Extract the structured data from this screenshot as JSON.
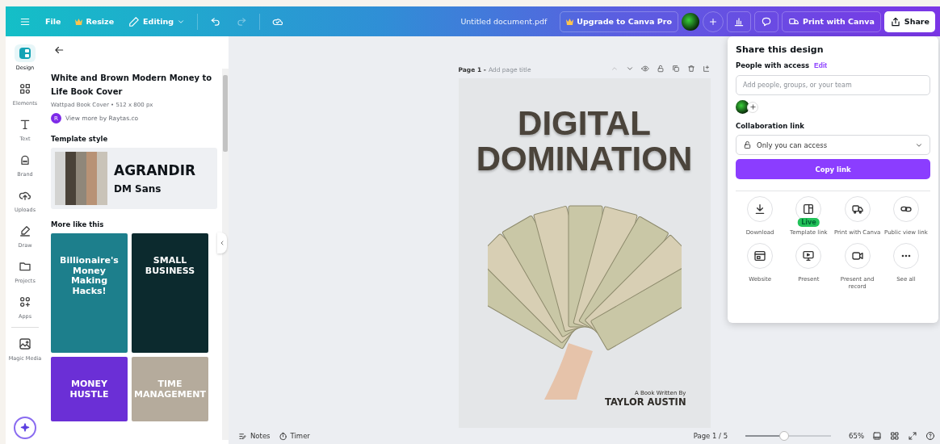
{
  "topbar": {
    "menu_items": [
      {
        "label": "File",
        "kind": "plain"
      },
      {
        "label": "Resize",
        "kind": "crown"
      },
      {
        "label": "Editing",
        "kind": "mode"
      }
    ],
    "document_title": "Untitled document.pdf",
    "upgrade_button": "Upgrade to Canva Pro",
    "print_button": "Print with Canva",
    "share_button": {
      "label": "Share",
      "selected": true
    }
  },
  "rail": {
    "items": [
      {
        "label": "Design",
        "selected": true
      },
      {
        "label": "Elements",
        "selected": false
      },
      {
        "label": "Text",
        "selected": false
      },
      {
        "label": "Brand",
        "selected": false
      },
      {
        "label": "Uploads",
        "selected": false
      },
      {
        "label": "Draw",
        "selected": false
      },
      {
        "label": "Projects",
        "selected": false
      },
      {
        "label": "Apps",
        "selected": false
      },
      {
        "label": "Magic Media",
        "selected": false
      }
    ]
  },
  "panel": {
    "title": "White and Brown Modern Money to Life Book Cover",
    "meta": "Wattpad Book Cover • 512 x 800 px",
    "creator_initial": "R",
    "creator_link": "View more by Raytas.co",
    "style_heading": "Template style",
    "palette": [
      {
        "color": "#d3d3d1"
      },
      {
        "color": "#4a4238"
      },
      {
        "color": "#8f877a"
      },
      {
        "color": "#b89275"
      },
      {
        "color": "#c9c3b8"
      }
    ],
    "heading_font": "AGRANDIR",
    "body_font": "DM Sans",
    "more_heading": "More like this",
    "templates": [
      {
        "title": "Billionaire's Money Making Hacks!",
        "color": "#1d7f8c"
      },
      {
        "title": "SMALL BUSINESS",
        "color": "#0c2a2e"
      },
      {
        "title": "MONEY HUSTLE",
        "color": "#6b2fd6"
      },
      {
        "title": "TIME MANAGEMENT",
        "color": "#b5ab9c"
      }
    ]
  },
  "canvas": {
    "page_label": "Page 1 -",
    "page_title_placeholder": "Add page title",
    "design": {
      "title_lines": [
        "DIGITAL",
        "DOMINATION"
      ],
      "byline": "A Book Written By",
      "author": "TAYLOR AUSTIN"
    }
  },
  "bottom_bar": {
    "notes": "Notes",
    "timer": "Timer",
    "page_counter": "Page 1 / 5",
    "zoom": {
      "level": 0.45
    },
    "zoom_reading": "65%"
  },
  "share_panel": {
    "title": "Share this design",
    "access_heading": "People with access",
    "edit_link": "Edit",
    "people_placeholder": "Add people, groups, or your team",
    "link_heading": "Collaboration link",
    "link_access": "Only you can access",
    "copy_button": "Copy link",
    "options": [
      {
        "label": "Download"
      },
      {
        "label": "Template link",
        "badge": "Live"
      },
      {
        "label": "Print with Canva"
      },
      {
        "label": "Public view link"
      },
      {
        "label": "Website"
      },
      {
        "label": "Present"
      },
      {
        "label": "Present and record"
      },
      {
        "label": "See all"
      }
    ]
  }
}
